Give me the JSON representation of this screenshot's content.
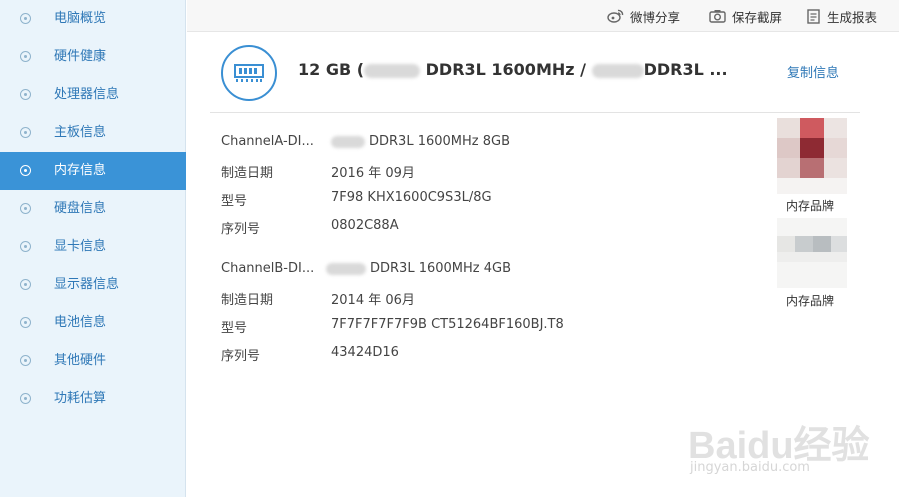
{
  "sidebar": {
    "items": [
      {
        "label": "电脑概览"
      },
      {
        "label": "硬件健康"
      },
      {
        "label": "处理器信息"
      },
      {
        "label": "主板信息"
      },
      {
        "label": "内存信息",
        "active": true
      },
      {
        "label": "硬盘信息"
      },
      {
        "label": "显卡信息"
      },
      {
        "label": "显示器信息"
      },
      {
        "label": "电池信息"
      },
      {
        "label": "其他硬件"
      },
      {
        "label": "功耗估算"
      }
    ]
  },
  "toolbar": {
    "weibo_share": "微博分享",
    "save_screenshot": "保存截屏",
    "generate_report": "生成报表"
  },
  "summary": {
    "prefix": "12 GB (",
    "part1": "DDR3L 1600MHz /",
    "part2": "DDR3L ..."
  },
  "copy_label": "复制信息",
  "channelA": {
    "title": "ChannelA-DI...",
    "value": "DDR3L 1600MHz 8GB",
    "rows": [
      {
        "label": "制造日期",
        "value": "2016 年 09月"
      },
      {
        "label": "型号",
        "value": "7F98 KHX1600C9S3L/8G"
      },
      {
        "label": "序列号",
        "value": "0802C88A"
      }
    ],
    "brand_caption": "内存品牌"
  },
  "channelB": {
    "title": "ChannelB-DI...",
    "value": "DDR3L 1600MHz 4GB",
    "rows": [
      {
        "label": "制造日期",
        "value": "2014 年 06月"
      },
      {
        "label": "型号",
        "value": "7F7F7F7F7F9B CT51264BF160BJ.T8"
      },
      {
        "label": "序列号",
        "value": "43424D16"
      }
    ],
    "brand_caption": "内存品牌"
  },
  "watermark": {
    "main": "Baidu经验",
    "sub": "jingyan.baidu.com"
  },
  "colors": {
    "sidebar_bg": "#eaf4fb",
    "active": "#3a93d7",
    "link": "#2f78b7"
  }
}
